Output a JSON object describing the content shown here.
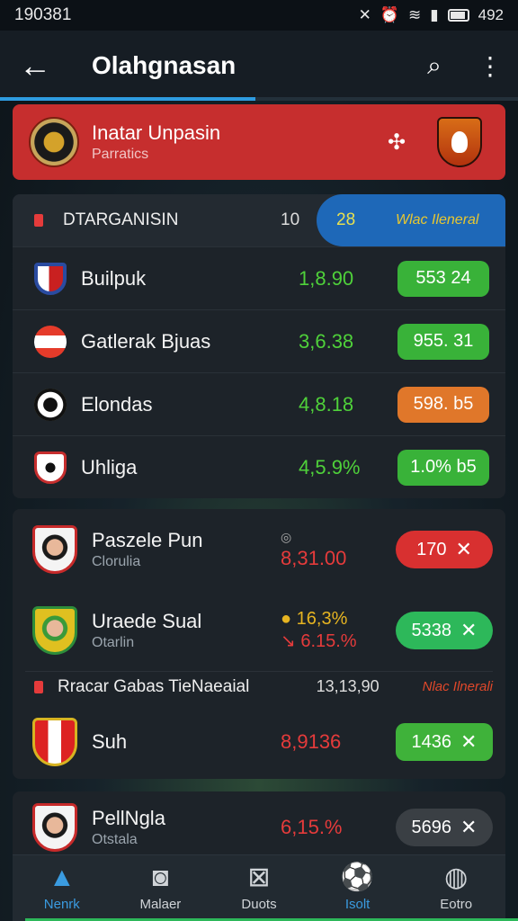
{
  "status": {
    "time": "190381",
    "battery": "492"
  },
  "appbar": {
    "title": "Olahgnasan"
  },
  "match": {
    "title": "Inatar Unpasin",
    "subtitle": "Parratics"
  },
  "league1": {
    "name": "DTARGANISIN",
    "count": "10",
    "pill_num": "28",
    "pill_label": "Wlac Ileneral"
  },
  "rows": [
    {
      "team": "Builpuk",
      "score": "1,8.90",
      "odds": "553 24",
      "color": "#39b239"
    },
    {
      "team": "Gatlerak Bjuas",
      "score": "3,6.38",
      "odds": "955. 31",
      "color": "#39b239"
    },
    {
      "team": "Elondas",
      "score": "4,8.18",
      "odds": "598. b5",
      "color": "#e0772a"
    },
    {
      "team": "Uhliga",
      "score": "4,5.9%",
      "odds": "1.0% b5",
      "color": "#39b239"
    }
  ],
  "matches": [
    {
      "name": "Paszele Pun",
      "sub": "Clorulia",
      "score": "8,31.00",
      "odds": "170"
    },
    {
      "name": "Uraede Sual",
      "sub": "Otarlin",
      "score_top": "16,3%",
      "score_bot": "6.15.%",
      "odds": "5338"
    }
  ],
  "league2": {
    "name": "Rracar Gabas TieNaeaial",
    "num": "13,13,90",
    "label": "Nlac Ilnerali"
  },
  "match3": {
    "name": "Suh",
    "score": "8,9136",
    "odds": "1436"
  },
  "match4": {
    "name": "PellNgla",
    "sub": "Otstala",
    "score": "6,15.%",
    "odds": "5696"
  },
  "nav": [
    {
      "label": "Nenrk",
      "icon": "home-icon",
      "active": true
    },
    {
      "label": "Malaer",
      "icon": "gamepad-icon",
      "active": false
    },
    {
      "label": "Duots",
      "icon": "ticket-icon",
      "active": false
    },
    {
      "label": "Isolt",
      "icon": "ball-icon",
      "active": true
    },
    {
      "label": "Eotro",
      "icon": "whistle-icon",
      "active": false
    }
  ]
}
